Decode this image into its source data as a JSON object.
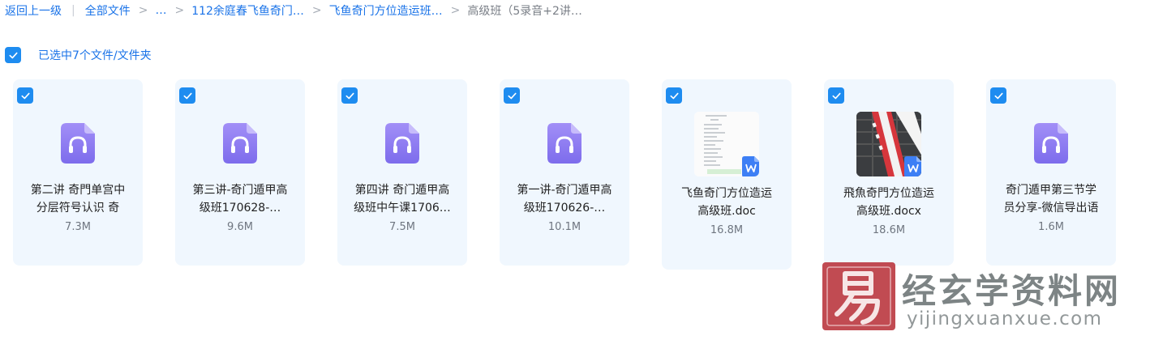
{
  "breadcrumb": {
    "back": "返回上一级",
    "all_files": "全部文件",
    "ellipsis": "…",
    "folder1": "112余庭春飞鱼奇门…",
    "folder2": "飞鱼奇门方位造运班…",
    "current": "高级班（5录音+2讲…"
  },
  "selection": {
    "text": "已选中7个文件/文件夹"
  },
  "files": [
    {
      "line1": "第二讲 奇門单宫中",
      "line2": "分层符号认识 奇",
      "size": "7.3M",
      "kind": "audio"
    },
    {
      "line1": "第三讲-奇门遁甲高",
      "line2": "级班170628-…",
      "size": "9.6M",
      "kind": "audio"
    },
    {
      "line1": "第四讲 奇门遁甲高",
      "line2": "级班中午课1706…",
      "size": "7.5M",
      "kind": "audio"
    },
    {
      "line1": "第一讲-奇门遁甲高",
      "line2": "级班170626-…",
      "size": "10.1M",
      "kind": "audio"
    },
    {
      "line1": "飞鱼奇门方位造运",
      "line2": "高级班.doc",
      "size": "16.8M",
      "kind": "doc"
    },
    {
      "line1": "飛魚奇門方位造运",
      "line2": "高级班.docx",
      "size": "18.6M",
      "kind": "docx"
    },
    {
      "line1": "奇门遁甲第三节学",
      "line2": "员分享-微信导出语",
      "size": "1.6M",
      "kind": "audio"
    }
  ],
  "watermark": {
    "seal_char": "易",
    "title": "经玄学资料网",
    "url": "yijingxuanxue.com"
  },
  "icons": {
    "checkbox": "check-icon",
    "audio": "audio-file-icon",
    "word": "word-doc-icon"
  },
  "colors": {
    "accent": "#1e8cf0",
    "link": "#1a73e8",
    "card_bg": "#f0f7fe",
    "audio_icon": "#8b7cf0",
    "word_badge": "#3d7ff5",
    "seal": "#b8323a"
  }
}
